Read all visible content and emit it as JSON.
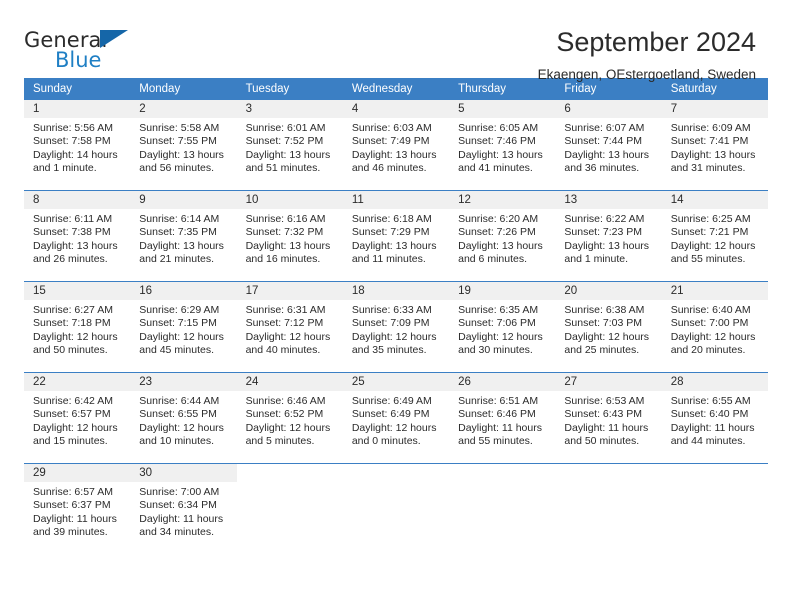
{
  "brand": {
    "name_part1": "General",
    "name_part2": "Blue"
  },
  "header": {
    "title": "September 2024",
    "subtitle": "Ekaengen, OEstergoetland, Sweden"
  },
  "calendar": {
    "weekday_headers": [
      "Sunday",
      "Monday",
      "Tuesday",
      "Wednesday",
      "Thursday",
      "Friday",
      "Saturday"
    ],
    "accent_color": "#3b7fc4",
    "daynum_bg": "#f0f0f0",
    "weeks": [
      [
        {
          "day": "1",
          "sunrise": "Sunrise: 5:56 AM",
          "sunset": "Sunset: 7:58 PM",
          "daylight1": "Daylight: 14 hours",
          "daylight2": "and 1 minute."
        },
        {
          "day": "2",
          "sunrise": "Sunrise: 5:58 AM",
          "sunset": "Sunset: 7:55 PM",
          "daylight1": "Daylight: 13 hours",
          "daylight2": "and 56 minutes."
        },
        {
          "day": "3",
          "sunrise": "Sunrise: 6:01 AM",
          "sunset": "Sunset: 7:52 PM",
          "daylight1": "Daylight: 13 hours",
          "daylight2": "and 51 minutes."
        },
        {
          "day": "4",
          "sunrise": "Sunrise: 6:03 AM",
          "sunset": "Sunset: 7:49 PM",
          "daylight1": "Daylight: 13 hours",
          "daylight2": "and 46 minutes."
        },
        {
          "day": "5",
          "sunrise": "Sunrise: 6:05 AM",
          "sunset": "Sunset: 7:46 PM",
          "daylight1": "Daylight: 13 hours",
          "daylight2": "and 41 minutes."
        },
        {
          "day": "6",
          "sunrise": "Sunrise: 6:07 AM",
          "sunset": "Sunset: 7:44 PM",
          "daylight1": "Daylight: 13 hours",
          "daylight2": "and 36 minutes."
        },
        {
          "day": "7",
          "sunrise": "Sunrise: 6:09 AM",
          "sunset": "Sunset: 7:41 PM",
          "daylight1": "Daylight: 13 hours",
          "daylight2": "and 31 minutes."
        }
      ],
      [
        {
          "day": "8",
          "sunrise": "Sunrise: 6:11 AM",
          "sunset": "Sunset: 7:38 PM",
          "daylight1": "Daylight: 13 hours",
          "daylight2": "and 26 minutes."
        },
        {
          "day": "9",
          "sunrise": "Sunrise: 6:14 AM",
          "sunset": "Sunset: 7:35 PM",
          "daylight1": "Daylight: 13 hours",
          "daylight2": "and 21 minutes."
        },
        {
          "day": "10",
          "sunrise": "Sunrise: 6:16 AM",
          "sunset": "Sunset: 7:32 PM",
          "daylight1": "Daylight: 13 hours",
          "daylight2": "and 16 minutes."
        },
        {
          "day": "11",
          "sunrise": "Sunrise: 6:18 AM",
          "sunset": "Sunset: 7:29 PM",
          "daylight1": "Daylight: 13 hours",
          "daylight2": "and 11 minutes."
        },
        {
          "day": "12",
          "sunrise": "Sunrise: 6:20 AM",
          "sunset": "Sunset: 7:26 PM",
          "daylight1": "Daylight: 13 hours",
          "daylight2": "and 6 minutes."
        },
        {
          "day": "13",
          "sunrise": "Sunrise: 6:22 AM",
          "sunset": "Sunset: 7:23 PM",
          "daylight1": "Daylight: 13 hours",
          "daylight2": "and 1 minute."
        },
        {
          "day": "14",
          "sunrise": "Sunrise: 6:25 AM",
          "sunset": "Sunset: 7:21 PM",
          "daylight1": "Daylight: 12 hours",
          "daylight2": "and 55 minutes."
        }
      ],
      [
        {
          "day": "15",
          "sunrise": "Sunrise: 6:27 AM",
          "sunset": "Sunset: 7:18 PM",
          "daylight1": "Daylight: 12 hours",
          "daylight2": "and 50 minutes."
        },
        {
          "day": "16",
          "sunrise": "Sunrise: 6:29 AM",
          "sunset": "Sunset: 7:15 PM",
          "daylight1": "Daylight: 12 hours",
          "daylight2": "and 45 minutes."
        },
        {
          "day": "17",
          "sunrise": "Sunrise: 6:31 AM",
          "sunset": "Sunset: 7:12 PM",
          "daylight1": "Daylight: 12 hours",
          "daylight2": "and 40 minutes."
        },
        {
          "day": "18",
          "sunrise": "Sunrise: 6:33 AM",
          "sunset": "Sunset: 7:09 PM",
          "daylight1": "Daylight: 12 hours",
          "daylight2": "and 35 minutes."
        },
        {
          "day": "19",
          "sunrise": "Sunrise: 6:35 AM",
          "sunset": "Sunset: 7:06 PM",
          "daylight1": "Daylight: 12 hours",
          "daylight2": "and 30 minutes."
        },
        {
          "day": "20",
          "sunrise": "Sunrise: 6:38 AM",
          "sunset": "Sunset: 7:03 PM",
          "daylight1": "Daylight: 12 hours",
          "daylight2": "and 25 minutes."
        },
        {
          "day": "21",
          "sunrise": "Sunrise: 6:40 AM",
          "sunset": "Sunset: 7:00 PM",
          "daylight1": "Daylight: 12 hours",
          "daylight2": "and 20 minutes."
        }
      ],
      [
        {
          "day": "22",
          "sunrise": "Sunrise: 6:42 AM",
          "sunset": "Sunset: 6:57 PM",
          "daylight1": "Daylight: 12 hours",
          "daylight2": "and 15 minutes."
        },
        {
          "day": "23",
          "sunrise": "Sunrise: 6:44 AM",
          "sunset": "Sunset: 6:55 PM",
          "daylight1": "Daylight: 12 hours",
          "daylight2": "and 10 minutes."
        },
        {
          "day": "24",
          "sunrise": "Sunrise: 6:46 AM",
          "sunset": "Sunset: 6:52 PM",
          "daylight1": "Daylight: 12 hours",
          "daylight2": "and 5 minutes."
        },
        {
          "day": "25",
          "sunrise": "Sunrise: 6:49 AM",
          "sunset": "Sunset: 6:49 PM",
          "daylight1": "Daylight: 12 hours",
          "daylight2": "and 0 minutes."
        },
        {
          "day": "26",
          "sunrise": "Sunrise: 6:51 AM",
          "sunset": "Sunset: 6:46 PM",
          "daylight1": "Daylight: 11 hours",
          "daylight2": "and 55 minutes."
        },
        {
          "day": "27",
          "sunrise": "Sunrise: 6:53 AM",
          "sunset": "Sunset: 6:43 PM",
          "daylight1": "Daylight: 11 hours",
          "daylight2": "and 50 minutes."
        },
        {
          "day": "28",
          "sunrise": "Sunrise: 6:55 AM",
          "sunset": "Sunset: 6:40 PM",
          "daylight1": "Daylight: 11 hours",
          "daylight2": "and 44 minutes."
        }
      ],
      [
        {
          "day": "29",
          "sunrise": "Sunrise: 6:57 AM",
          "sunset": "Sunset: 6:37 PM",
          "daylight1": "Daylight: 11 hours",
          "daylight2": "and 39 minutes."
        },
        {
          "day": "30",
          "sunrise": "Sunrise: 7:00 AM",
          "sunset": "Sunset: 6:34 PM",
          "daylight1": "Daylight: 11 hours",
          "daylight2": "and 34 minutes."
        },
        {
          "day": "",
          "sunrise": "",
          "sunset": "",
          "daylight1": "",
          "daylight2": ""
        },
        {
          "day": "",
          "sunrise": "",
          "sunset": "",
          "daylight1": "",
          "daylight2": ""
        },
        {
          "day": "",
          "sunrise": "",
          "sunset": "",
          "daylight1": "",
          "daylight2": ""
        },
        {
          "day": "",
          "sunrise": "",
          "sunset": "",
          "daylight1": "",
          "daylight2": ""
        },
        {
          "day": "",
          "sunrise": "",
          "sunset": "",
          "daylight1": "",
          "daylight2": ""
        }
      ]
    ]
  }
}
